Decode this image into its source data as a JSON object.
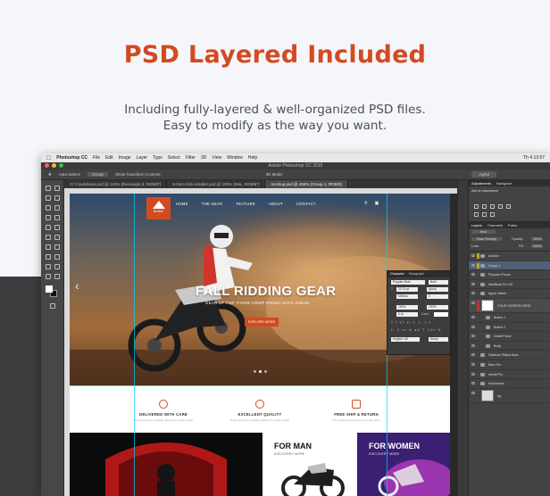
{
  "headline": {
    "title": "PSD Layered Included",
    "line1": "Including fully-layered & well-organized PSD files.",
    "line2": "Easy to modify as the way you want."
  },
  "mac_menu": {
    "items": [
      "Photoshop CC",
      "File",
      "Edit",
      "Image",
      "Layer",
      "Type",
      "Select",
      "Filter",
      "3D",
      "View",
      "Window",
      "Help"
    ],
    "clock": "Th 4 13:57"
  },
  "window_title": "Adobe Photoshop CC 2015",
  "options_bar": {
    "auto_select": "Auto-Select:",
    "group": "Group",
    "transform": "Show Transform Controls",
    "mode": "3D Mode:",
    "preset": "Joyful"
  },
  "doc_tabs": [
    {
      "label": "27-Countdown.psd @ 122% (Rectangle 8, RGB/8*)",
      "active": false
    },
    {
      "label": "5-Gen-click-installer.psd @ 100% (Mac, RGB/8*)",
      "active": false
    },
    {
      "label": "mockup.psd @ 456% (Group 1, RGB/8)",
      "active": true
    }
  ],
  "colors": {
    "accent": "#d24a22",
    "foreground_swatch": "#ffffff",
    "background_swatch": "#111111"
  },
  "website": {
    "logo_text": "BAIKM",
    "nav": [
      "HOME",
      "THE GEAR",
      "FEATURE",
      "ABOUT",
      "CONTACT"
    ],
    "hero_title": "FALL RIDDING GEAR",
    "hero_subtitle": "GEAR UP FOR THOSE CRISP RIDING DAYS AHEAD",
    "hero_button": "EXPLORE MORE",
    "features": [
      {
        "title": "DELIVERED WITH CARE",
        "desc": "Each product is carefully packed for a safe arrival"
      },
      {
        "title": "EXCELLENT QUALITY",
        "desc": "Each product is carefully packed for a safe arrival"
      },
      {
        "title": "FREE SHIP & RETURN",
        "desc": "Free delivery and returns on every order"
      }
    ],
    "tiles": [
      {
        "title": "FOR MAN",
        "sub": "DISCOVERY MORE"
      },
      {
        "title": "FOR WOMEN",
        "sub": "DISCOVERY MORE"
      }
    ]
  },
  "character_panel": {
    "tabs": [
      "Character",
      "Paragraph"
    ],
    "font": "Poppins Bold",
    "style": "Bold",
    "size": "23.74 pt",
    "leading": "(Auto)",
    "kerning": "Metrics",
    "tracking": "0",
    "vscale": "100%",
    "hscale": "100%",
    "baseline": "0 pt",
    "color_label": "Color:",
    "language": "English: UK",
    "aa": "Sharp"
  },
  "right_panels": {
    "adjust_tabs": [
      "Adjustments",
      "Navigator"
    ],
    "adjust_label": "Add an adjustment",
    "layers_tabs": [
      "Layers",
      "Channels",
      "Paths"
    ],
    "kind": "Kind",
    "blend": "Pass Through",
    "opacity_label": "Opacity:",
    "opacity": "100%",
    "fill_label": "Fill:",
    "fill": "100%",
    "lock_label": "Lock:",
    "layers": [
      {
        "name": "Archive",
        "type": "folder",
        "selected": false,
        "tag": "yellow"
      },
      {
        "name": "Group 1",
        "type": "folder",
        "selected": true,
        "tag": "yellow"
      },
      {
        "name": "Polymer Phone",
        "type": "folder",
        "selected": false,
        "tag": ""
      },
      {
        "name": "MacBook Pro 16\"",
        "type": "folder",
        "selected": false,
        "tag": ""
      },
      {
        "name": "Apple Watch",
        "type": "folder",
        "selected": false,
        "tag": ""
      },
      {
        "name": "YOUR SCREEN HERE",
        "type": "smart",
        "selected": false,
        "tag": "red"
      },
      {
        "name": "Button 1",
        "type": "folder",
        "selected": false,
        "tag": ""
      },
      {
        "name": "Button 2",
        "type": "folder",
        "selected": false,
        "tag": ""
      },
      {
        "name": "Detail Panel",
        "type": "folder",
        "selected": false,
        "tag": ""
      },
      {
        "name": "Body",
        "type": "folder",
        "selected": false,
        "tag": ""
      },
      {
        "name": "Rainbow Status Bars",
        "type": "folder",
        "selected": false,
        "tag": ""
      },
      {
        "name": "Bars Sm",
        "type": "folder",
        "selected": false,
        "tag": ""
      },
      {
        "name": "Inbuilt Pro",
        "type": "folder",
        "selected": false,
        "tag": ""
      },
      {
        "name": "Earphones",
        "type": "folder",
        "selected": false,
        "tag": ""
      },
      {
        "name": "bg",
        "type": "layer",
        "selected": false,
        "tag": ""
      }
    ]
  }
}
